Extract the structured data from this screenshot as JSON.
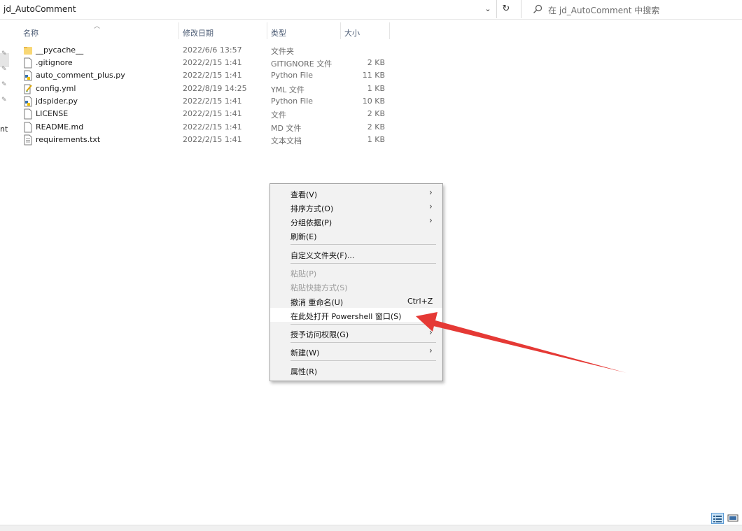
{
  "address": {
    "path": "jd_AutoComment"
  },
  "search": {
    "placeholder": "在 jd_AutoComment 中搜索"
  },
  "nav": {
    "truncated_label": "nt"
  },
  "columns": {
    "name": "名称",
    "date": "修改日期",
    "type": "类型",
    "size": "大小"
  },
  "files": [
    {
      "name": "__pycache__",
      "date": "2022/6/6 13:57",
      "type": "文件夹",
      "size": "",
      "icon": "folder-icon"
    },
    {
      "name": ".gitignore",
      "date": "2022/2/15 1:41",
      "type": "GITIGNORE 文件",
      "size": "2 KB",
      "icon": "file-icon"
    },
    {
      "name": "auto_comment_plus.py",
      "date": "2022/2/15 1:41",
      "type": "Python File",
      "size": "11 KB",
      "icon": "python-file-icon"
    },
    {
      "name": "config.yml",
      "date": "2022/8/19 14:25",
      "type": "YML 文件",
      "size": "1 KB",
      "icon": "yml-file-icon"
    },
    {
      "name": "jdspider.py",
      "date": "2022/2/15 1:41",
      "type": "Python File",
      "size": "10 KB",
      "icon": "python-file-icon"
    },
    {
      "name": "LICENSE",
      "date": "2022/2/15 1:41",
      "type": "文件",
      "size": "2 KB",
      "icon": "file-icon"
    },
    {
      "name": "README.md",
      "date": "2022/2/15 1:41",
      "type": "MD 文件",
      "size": "2 KB",
      "icon": "file-icon"
    },
    {
      "name": "requirements.txt",
      "date": "2022/2/15 1:41",
      "type": "文本文档",
      "size": "1 KB",
      "icon": "text-file-icon"
    }
  ],
  "menu": {
    "view": "查看(V)",
    "sort": "排序方式(O)",
    "group": "分组依据(P)",
    "refresh": "刷新(E)",
    "customize": "自定义文件夹(F)...",
    "paste": "粘贴(P)",
    "paste_shortcut": "粘贴快捷方式(S)",
    "undo_rename": "撤消 重命名(U)",
    "undo_shortcut": "Ctrl+Z",
    "powershell": "在此处打开 Powershell 窗口(S)",
    "give_access": "授予访问权限(G)",
    "new": "新建(W)",
    "properties": "属性(R)"
  },
  "colors": {
    "accent": "#0078d7",
    "arrow": "#e53935",
    "header_text": "#4a5a73"
  }
}
